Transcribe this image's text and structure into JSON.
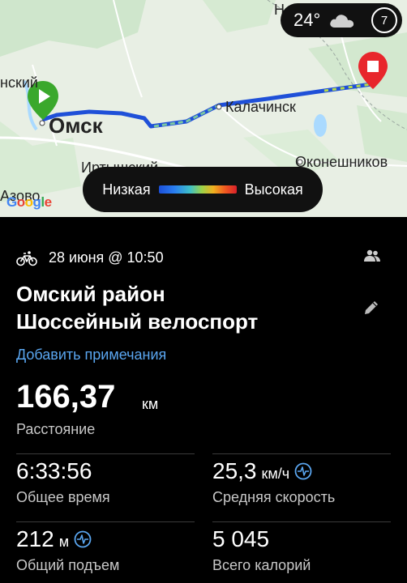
{
  "map": {
    "labels": {
      "top_partial": "Н",
      "left_partial": "нский",
      "omsk": "Омск",
      "kalachinsk": "Калачинск",
      "okoneshnikovo": "Оконешников",
      "irtyshsky": "Иртышский",
      "azovo": "Азово"
    },
    "google": "Google"
  },
  "weather": {
    "temperature": "24°",
    "icon": "cloud-icon",
    "badge": "7"
  },
  "legend": {
    "low": "Низкая",
    "high": "Высокая"
  },
  "activity": {
    "date": "28 июня @ 10:50",
    "title_line1": "Омский район",
    "title_line2": "Шоссейный велоспорт",
    "add_notes": "Добавить примечания",
    "distance": {
      "value": "166,37",
      "unit": "км",
      "label": "Расстояние"
    },
    "stats": [
      {
        "value": "6:33:56",
        "unit": "",
        "label": "Общее время",
        "icon": ""
      },
      {
        "value": "25,3",
        "unit": "км/ч",
        "label": "Средняя скорость",
        "icon": "heart-rate-icon"
      },
      {
        "value": "212",
        "unit": "м",
        "label": "Общий подъем",
        "icon": "heart-rate-icon"
      },
      {
        "value": "5 045",
        "unit": "",
        "label": "Всего калорий",
        "icon": ""
      }
    ]
  },
  "colors": {
    "accent_link": "#5aa6f0",
    "start_marker": "#3aa82c",
    "end_marker": "#e8262c"
  }
}
